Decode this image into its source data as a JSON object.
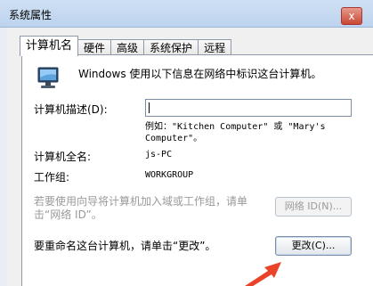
{
  "window": {
    "title": "系统属性",
    "close_label": "x"
  },
  "tabs": [
    {
      "label": "计算机名",
      "active": true
    },
    {
      "label": "硬件",
      "active": false
    },
    {
      "label": "高级",
      "active": false
    },
    {
      "label": "系统保护",
      "active": false
    },
    {
      "label": "远程",
      "active": false
    }
  ],
  "content": {
    "intro": "Windows 使用以下信息在网络中标识这台计算机。",
    "desc_label": "计算机描述(D):",
    "desc_value": "",
    "example_line1": "例如：\"Kitchen Computer\" 或 \"Mary's",
    "example_line2": "Computer\"。",
    "fullname_label": "计算机全名:",
    "fullname_value": "js-PC",
    "workgroup_label": "工作组:",
    "workgroup_value": "WORKGROUP",
    "wizard_line1": "若要使用向导将计算机加入域或工作组，请单",
    "wizard_line2": "击“网络 ID”。",
    "network_button": "网络 ID(N)...",
    "rename_text": "要重命名这台计算机，请单击“更改”。",
    "change_button": "更改(C)..."
  },
  "colors": {
    "annotation_arrow": "#e9442a"
  },
  "icons": {
    "computer": "computer-icon",
    "annotation_arrow": "red-arrow-annotation"
  }
}
